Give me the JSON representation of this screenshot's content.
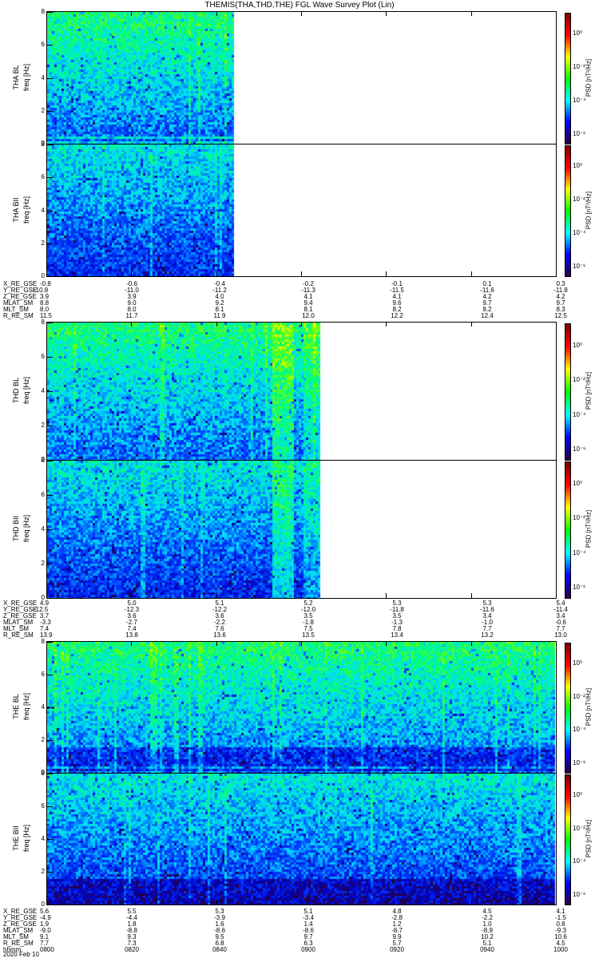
{
  "title": "THEMIS(THA,THD,THE) FGL Wave Survey Plot (Lin)",
  "colorbar": {
    "title": "PSD [nT²/Hz]",
    "ticks": [
      "10⁰",
      "10⁻²",
      "10⁻⁴",
      "10⁻⁶"
    ],
    "colors": [
      "#2a0040",
      "#0000ff",
      "#00ffff",
      "#00ff00",
      "#ffff00",
      "#ff0000",
      "#800000"
    ]
  },
  "chart_data": {
    "type": "heatmap",
    "title": "THEMIS(THA,THD,THE) FGL Wave Survey Plot (Lin)",
    "ylabel": "freq [Hz]",
    "yticks": [
      "0",
      "2",
      "4",
      "6",
      "8"
    ],
    "ylim": [
      0,
      8
    ],
    "zlabel": "PSD [nT²/Hz]",
    "zlim_log10": [
      -7,
      1
    ],
    "xlabel": "hhmm",
    "date": "2020 Feb 10",
    "xlim": [
      "0800",
      "1000"
    ],
    "groups": [
      {
        "probe": "THA",
        "data_coverage_fraction": 0.37,
        "panels": [
          {
            "label": "THA BL",
            "ylabel": "freq [Hz]"
          },
          {
            "label": "THA BII",
            "ylabel": "freq [Hz]"
          }
        ],
        "ephemeris": [
          {
            "name": "X_RE_GSE",
            "values": [
              "-0.8",
              "-0.6",
              "-0.4",
              "-0.2",
              "-0.1",
              "0.1",
              "0.3"
            ]
          },
          {
            "name": "Y_RE_GSE",
            "values": [
              "-10.8",
              "-11.0",
              "-11.2",
              "-11.3",
              "-11.5",
              "-11.6",
              "-11.8"
            ]
          },
          {
            "name": "Z_RE_GSE",
            "values": [
              "3.9",
              "3.9",
              "4.0",
              "4.1",
              "4.1",
              "4.2",
              "4.2"
            ]
          },
          {
            "name": "MLAT_SM",
            "values": [
              "8.8",
              "9.0",
              "9.2",
              "9.4",
              "9.6",
              "9.7",
              "9.7"
            ]
          },
          {
            "name": "MLT_SM",
            "values": [
              "8.0",
              "8.0",
              "8.1",
              "8.1",
              "8.2",
              "8.2",
              "8.3"
            ]
          },
          {
            "name": "R_RE_SM",
            "values": [
              "11.5",
              "11.7",
              "11.9",
              "12.0",
              "12.2",
              "12.4",
              "12.5"
            ]
          }
        ]
      },
      {
        "probe": "THD",
        "data_coverage_fraction": 0.54,
        "panels": [
          {
            "label": "THD BL",
            "ylabel": "freq [Hz]"
          },
          {
            "label": "THD BII",
            "ylabel": "freq [Hz]"
          }
        ],
        "ephemeris": [
          {
            "name": "X_RE_GSE",
            "values": [
              "4.9",
              "5.0",
              "5.1",
              "5.2",
              "5.3",
              "5.3",
              "5.4"
            ]
          },
          {
            "name": "Y_RE_GSE",
            "values": [
              "-12.5",
              "-12.3",
              "-12.2",
              "-12.0",
              "-11.8",
              "-11.6",
              "-11.4"
            ]
          },
          {
            "name": "Z_RE_GSE",
            "values": [
              "3.7",
              "3.6",
              "3.6",
              "3.5",
              "3.5",
              "3.4",
              "3.4"
            ]
          },
          {
            "name": "MLAT_SM",
            "values": [
              "-3.3",
              "-2.7",
              "-2.2",
              "-1.8",
              "-1.3",
              "-1.0",
              "-0.6"
            ]
          },
          {
            "name": "MLT_SM",
            "values": [
              "7.4",
              "7.4",
              "7.6",
              "7.5",
              "7.8",
              "7.7",
              "7.7"
            ]
          },
          {
            "name": "R_RE_SM",
            "values": [
              "13.9",
              "13.8",
              "13.6",
              "13.5",
              "13.4",
              "13.2",
              "13.0"
            ]
          }
        ]
      },
      {
        "probe": "THE",
        "data_coverage_fraction": 1.0,
        "panels": [
          {
            "label": "THE BL",
            "ylabel": "freq [Hz]"
          },
          {
            "label": "THE BII",
            "ylabel": "freq [Hz]"
          }
        ],
        "ephemeris": [
          {
            "name": "X_RE_GSE",
            "values": [
              "5.6",
              "5.5",
              "5.3",
              "5.1",
              "4.8",
              "4.5",
              "4.1"
            ]
          },
          {
            "name": "Y_RE_GSE",
            "values": [
              "-4.9",
              "-4.4",
              "-3.9",
              "-3.4",
              "-2.8",
              "-2.2",
              "-1.5"
            ]
          },
          {
            "name": "Z_RE_GSE",
            "values": [
              "1.9",
              "1.8",
              "1.6",
              "1.4",
              "1.2",
              "1.0",
              "0.8"
            ]
          },
          {
            "name": "MLAT_SM",
            "values": [
              "-9.0",
              "-8.8",
              "-8.6",
              "-8.6",
              "-8.7",
              "-8.9",
              "-9.3"
            ]
          },
          {
            "name": "MLT_SM",
            "values": [
              "9.1",
              "9.3",
              "9.5",
              "9.7",
              "9.9",
              "10.2",
              "10.6"
            ]
          },
          {
            "name": "R_RE_SM",
            "values": [
              "7.7",
              "7.3",
              "6.8",
              "6.3",
              "5.7",
              "5.1",
              "4.5"
            ]
          },
          {
            "name": "hhmm",
            "values": [
              "0800",
              "0820",
              "0840",
              "0900",
              "0920",
              "0940",
              "1000"
            ]
          }
        ]
      }
    ]
  }
}
